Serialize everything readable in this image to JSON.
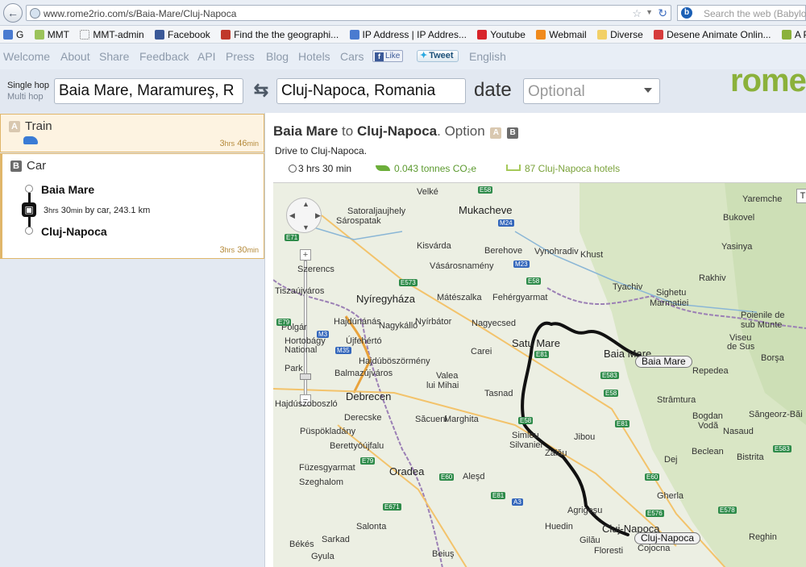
{
  "browser": {
    "url": "www.rome2rio.com/s/Baia-Mare/Cluj-Napoca",
    "search_placeholder": "Search the web (Babylon",
    "bookmarks": [
      {
        "label": "G",
        "color": "#4a7bd0"
      },
      {
        "label": "MMT",
        "color": "#9bc35a"
      },
      {
        "label": "MMT-admin",
        "color": "#ffffff"
      },
      {
        "label": "Facebook",
        "color": "#3b5998"
      },
      {
        "label": "Find the the geographi...",
        "color": "#c0392b"
      },
      {
        "label": "IP Address | IP Addres...",
        "color": "#4a7bd0"
      },
      {
        "label": "Youtube",
        "color": "#d8242a"
      },
      {
        "label": "Webmail",
        "color": "#f08a1c"
      },
      {
        "label": "Diverse",
        "color": "#f2d066"
      },
      {
        "label": "Desene Animate Onlin...",
        "color": "#d63c3c"
      },
      {
        "label": "A Pattern Languag",
        "color": "#8bb13b"
      }
    ]
  },
  "nav": {
    "items": [
      "Welcome",
      "About",
      "Share",
      "Feedback",
      "API",
      "Press",
      "Blog",
      "Hotels",
      "Cars"
    ],
    "like": "Like",
    "tweet": "Tweet",
    "language": "English"
  },
  "form": {
    "single_hop": "Single hop",
    "multi_hop": "Multi hop",
    "from": "Baia Mare, Maramureş, R",
    "to": "Cluj-Napoca, Romania",
    "date_label": "date",
    "date_placeholder": "Optional",
    "logo": "rome"
  },
  "routes": {
    "train": {
      "tag": "A",
      "name": "Train",
      "hours": "3",
      "mins": "46"
    },
    "car": {
      "tag": "B",
      "name": "Car",
      "from": "Baia Mare",
      "to": "Cluj-Napoca",
      "leg_h": "3",
      "leg_rest": "30",
      "leg_text": " by car, 243.1 km",
      "hours": "3",
      "mins": "30"
    },
    "units": {
      "hrs": "hrs",
      "min": "min"
    }
  },
  "detail": {
    "from": "Baia Mare",
    "to_word": " to ",
    "to": "Cluj-Napoca",
    "option": ". Option",
    "tag_a": "A",
    "tag_b": "B",
    "instruction": "Drive to Cluj-Napoca.",
    "duration": "3 hrs 30 min",
    "co2": "0.043 tonnes CO₂e",
    "hotels": "87 Cluj-Napoca hotels"
  },
  "map": {
    "labels": [
      {
        "t": "Velké",
        "c": "s"
      },
      {
        "t": "Satoraljaujhely",
        "c": "s"
      },
      {
        "t": "Sárospatak",
        "c": "s"
      },
      {
        "t": "Mukacheve",
        "c": "b"
      },
      {
        "t": "Yaremche",
        "c": "s"
      },
      {
        "t": "Bukovel",
        "c": "s"
      },
      {
        "t": "Yasinya",
        "c": "s"
      },
      {
        "t": "Kisvárda",
        "c": "s"
      },
      {
        "t": "Berehove",
        "c": "s"
      },
      {
        "t": "Vynohradiv",
        "c": "s"
      },
      {
        "t": "Khust",
        "c": "s"
      },
      {
        "t": "Vásárosnamény",
        "c": "s"
      },
      {
        "t": "Szerencs",
        "c": "s"
      },
      {
        "t": "Mátészalka",
        "c": "s"
      },
      {
        "t": "Fehérgyarmat",
        "c": "s"
      },
      {
        "t": "Tyachiv",
        "c": "s"
      },
      {
        "t": "Rakhiv",
        "c": "s"
      },
      {
        "t": "Nyíregyháza",
        "c": "b"
      },
      {
        "t": "Sighetu",
        "c": "s"
      },
      {
        "t": "Marmatiei",
        "c": "s"
      },
      {
        "t": "Nyírbátor",
        "c": "s"
      },
      {
        "t": "Hajdúnánás",
        "c": "s"
      },
      {
        "t": "Nagykálló",
        "c": "s"
      },
      {
        "t": "Nagyecsed",
        "c": "s"
      },
      {
        "t": "Polgár",
        "c": "s"
      },
      {
        "t": "Újfehértó",
        "c": "s"
      },
      {
        "t": "Satu Mare",
        "c": "b"
      },
      {
        "t": "Baia Mare",
        "c": "b"
      },
      {
        "t": "Poienile de",
        "c": "s"
      },
      {
        "t": "sub Munte",
        "c": "s"
      },
      {
        "t": "Viseu",
        "c": "s"
      },
      {
        "t": "de Sus",
        "c": "s"
      },
      {
        "t": "Borşa",
        "c": "s"
      },
      {
        "t": "Carei",
        "c": "s"
      },
      {
        "t": "Hajdúböszörmény",
        "c": "s"
      },
      {
        "t": "Balmazújváros",
        "c": "s"
      },
      {
        "t": "Debrecen",
        "c": "b"
      },
      {
        "t": "Valea",
        "c": "s"
      },
      {
        "t": "lui Mihai",
        "c": "s"
      },
      {
        "t": "Tasnad",
        "c": "s"
      },
      {
        "t": "Repedea",
        "c": "s"
      },
      {
        "t": "Strâmtura",
        "c": "s"
      },
      {
        "t": "Derecske",
        "c": "s"
      },
      {
        "t": "Săcueni",
        "c": "s"
      },
      {
        "t": "Marghita",
        "c": "s"
      },
      {
        "t": "Bogdan",
        "c": "s"
      },
      {
        "t": "Vodă",
        "c": "s"
      },
      {
        "t": "Săngeorz-Băi",
        "c": "s"
      },
      {
        "t": "Püspökladány",
        "c": "s"
      },
      {
        "t": "Simleu",
        "c": "s"
      },
      {
        "t": "Silvaniei",
        "c": "s"
      },
      {
        "t": "Jibou",
        "c": "s"
      },
      {
        "t": "Nasaud",
        "c": "s"
      },
      {
        "t": "Berettyóújfalu",
        "c": "s"
      },
      {
        "t": "Zalău",
        "c": "s"
      },
      {
        "t": "Dej",
        "c": "s"
      },
      {
        "t": "Beclean",
        "c": "s"
      },
      {
        "t": "Bistrita",
        "c": "s"
      },
      {
        "t": "Füzesgyarmat",
        "c": "s"
      },
      {
        "t": "Oradea",
        "c": "b"
      },
      {
        "t": "Aleşd",
        "c": "s"
      },
      {
        "t": "Szeghalom",
        "c": "s"
      },
      {
        "t": "Gherla",
        "c": "s"
      },
      {
        "t": "Agrigeşu",
        "c": "s"
      },
      {
        "t": "Salonta",
        "c": "s"
      },
      {
        "t": "Huedin",
        "c": "s"
      },
      {
        "t": "Cluj-Napoca",
        "c": "b"
      },
      {
        "t": "Sarkad",
        "c": "s"
      },
      {
        "t": "Gilău",
        "c": "s"
      },
      {
        "t": "Cojocna",
        "c": "s"
      },
      {
        "t": "Reghin",
        "c": "s"
      },
      {
        "t": "Békés",
        "c": "s"
      },
      {
        "t": "Gyula",
        "c": "s"
      },
      {
        "t": "Beiuş",
        "c": "s"
      },
      {
        "t": "Floresti",
        "c": "s"
      },
      {
        "t": "Hortobágy",
        "c": "s"
      },
      {
        "t": "National",
        "c": "s"
      },
      {
        "t": "Park",
        "c": "s"
      },
      {
        "t": "Hajdúszoboszló",
        "c": "s"
      },
      {
        "t": "Tiszaújváros",
        "c": "s"
      }
    ],
    "shields": [
      "E58",
      "M24",
      "E71",
      "E573",
      "M23",
      "E58",
      "M3",
      "E79",
      "M35",
      "E583",
      "E58",
      "E81",
      "E79",
      "E671",
      "E81",
      "E60",
      "A3",
      "E576",
      "E578",
      "E583",
      "E60",
      "E81",
      "E58"
    ],
    "callout_from": "Baia Mare",
    "callout_to": "Cluj-Napoca",
    "maptype": "T"
  }
}
